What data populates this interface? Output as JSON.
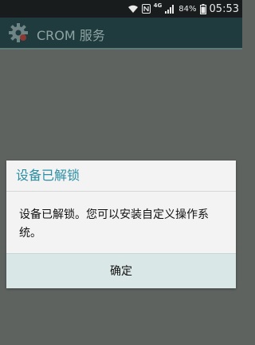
{
  "status_bar": {
    "network_label": "4G",
    "battery": "84%",
    "time": "05:53"
  },
  "app_bar": {
    "title": "CROM 服务",
    "icon": "gear-icon"
  },
  "dialog": {
    "title": "设备已解锁",
    "message": "设备已解锁。您可以安装自定义操作系统。",
    "confirm_label": "确定"
  },
  "colors": {
    "dialog_title": "#2b8fa4",
    "button_bg": "#d9e8e6",
    "scrim": "#5f6360"
  }
}
